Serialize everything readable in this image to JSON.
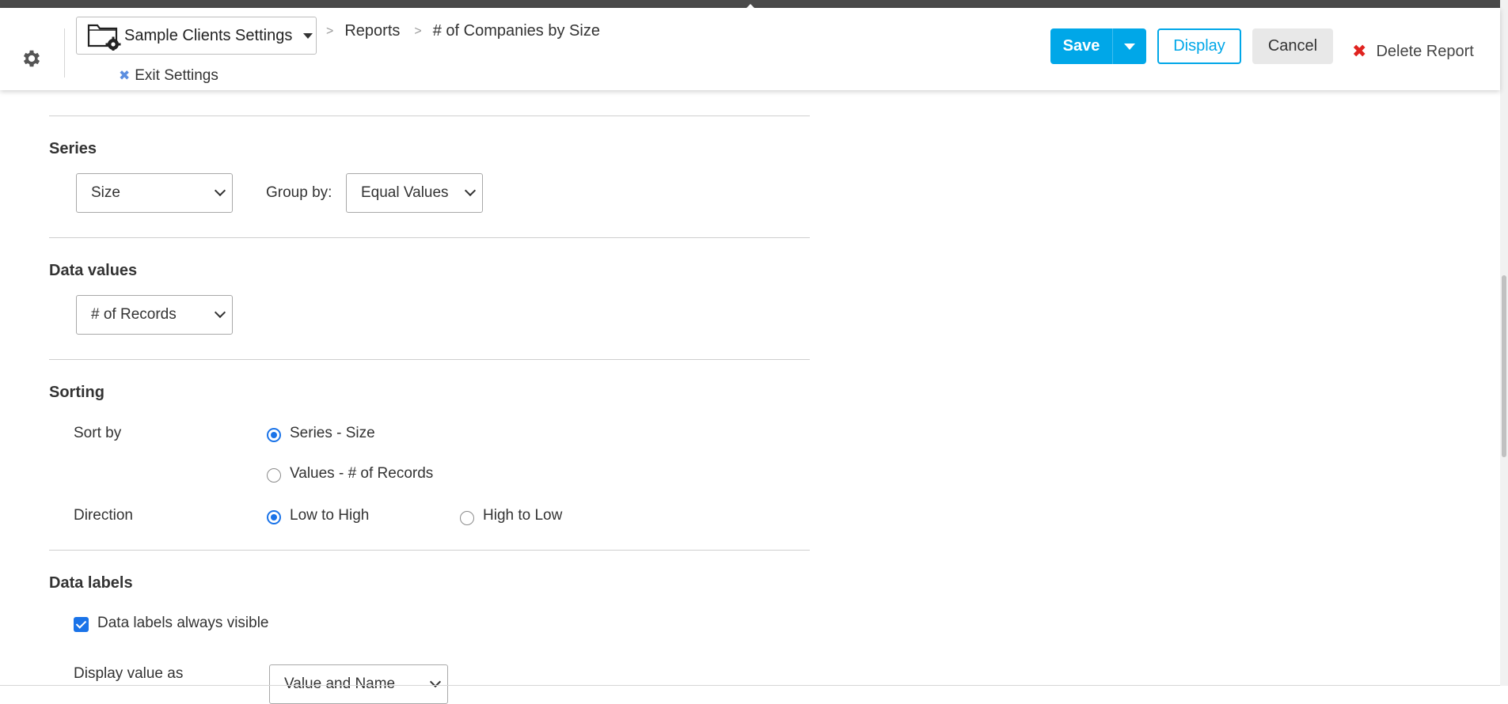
{
  "header": {
    "app_name": "Sample Clients Settings",
    "exit_label": "Exit Settings",
    "breadcrumb": [
      "Reports",
      "# of Companies by Size"
    ],
    "buttons": {
      "save": "Save",
      "display": "Display",
      "cancel": "Cancel",
      "delete": "Delete Report"
    }
  },
  "sections": {
    "series": {
      "title": "Series",
      "field": "Size",
      "group_by_label": "Group by:",
      "group_by_value": "Equal Values"
    },
    "data_values": {
      "title": "Data values",
      "field": "# of Records"
    },
    "sorting": {
      "title": "Sorting",
      "sort_by_label": "Sort by",
      "sort_by_options": [
        "Series - Size",
        "Values - # of Records"
      ],
      "sort_by_selected": 0,
      "direction_label": "Direction",
      "direction_options": [
        "Low to High",
        "High to Low"
      ],
      "direction_selected": 0
    },
    "data_labels": {
      "title": "Data labels",
      "always_visible_label": "Data labels always visible",
      "always_visible_checked": true,
      "display_value_label": "Display value as",
      "display_value": "Value and Name"
    }
  },
  "colors": {
    "primary": "#00a7e8",
    "radio_checked": "#1a73e8",
    "delete_x": "#e0231f",
    "exit_x": "#5b8ee0"
  }
}
